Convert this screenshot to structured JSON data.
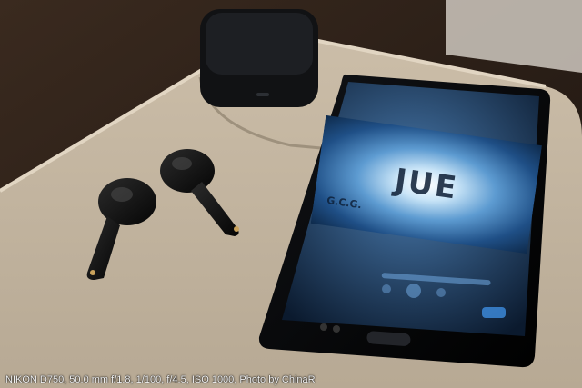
{
  "screen": {
    "logo_text": "JUE",
    "sub_text": "G.C.G."
  },
  "case_brand": "",
  "photo_caption": "NIKON D750, 50.0 mm f/1.8, 1/100, f/4.5, ISO 1000, Photo by ChinaR"
}
